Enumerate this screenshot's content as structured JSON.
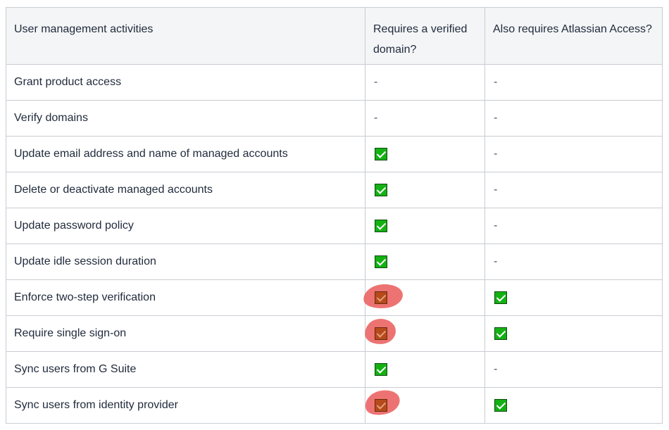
{
  "table": {
    "headers": [
      "User management activities",
      "Requires a verified domain?",
      "Also requires Atlassian Access?"
    ],
    "rows": [
      {
        "activity": "Grant product access",
        "verified": "-",
        "access": "-"
      },
      {
        "activity": "Verify domains",
        "verified": "-",
        "access": "-"
      },
      {
        "activity": "Update email address and name of managed accounts",
        "verified": "check",
        "access": "-"
      },
      {
        "activity": "Delete or deactivate managed accounts",
        "verified": "check",
        "access": "-"
      },
      {
        "activity": "Update password policy",
        "verified": "check",
        "access": "-"
      },
      {
        "activity": "Update idle session duration",
        "verified": "check",
        "access": "-"
      },
      {
        "activity": "Enforce two-step verification",
        "verified": "check-highlighted",
        "access": "check"
      },
      {
        "activity": "Require single sign-on",
        "verified": "check-highlighted",
        "access": "check"
      },
      {
        "activity": "Sync users from G Suite",
        "verified": "check",
        "access": "-"
      },
      {
        "activity": "Sync users from identity provider",
        "verified": "check-highlighted",
        "access": "check"
      }
    ]
  },
  "icons": {
    "check": "checkmark-icon",
    "highlight": "red-marker-highlight"
  },
  "colors": {
    "check_fill": "#13b113",
    "highlight_marker": "#ea5a5a",
    "header_bg": "#f4f5f7",
    "border": "#c8ccd2"
  }
}
